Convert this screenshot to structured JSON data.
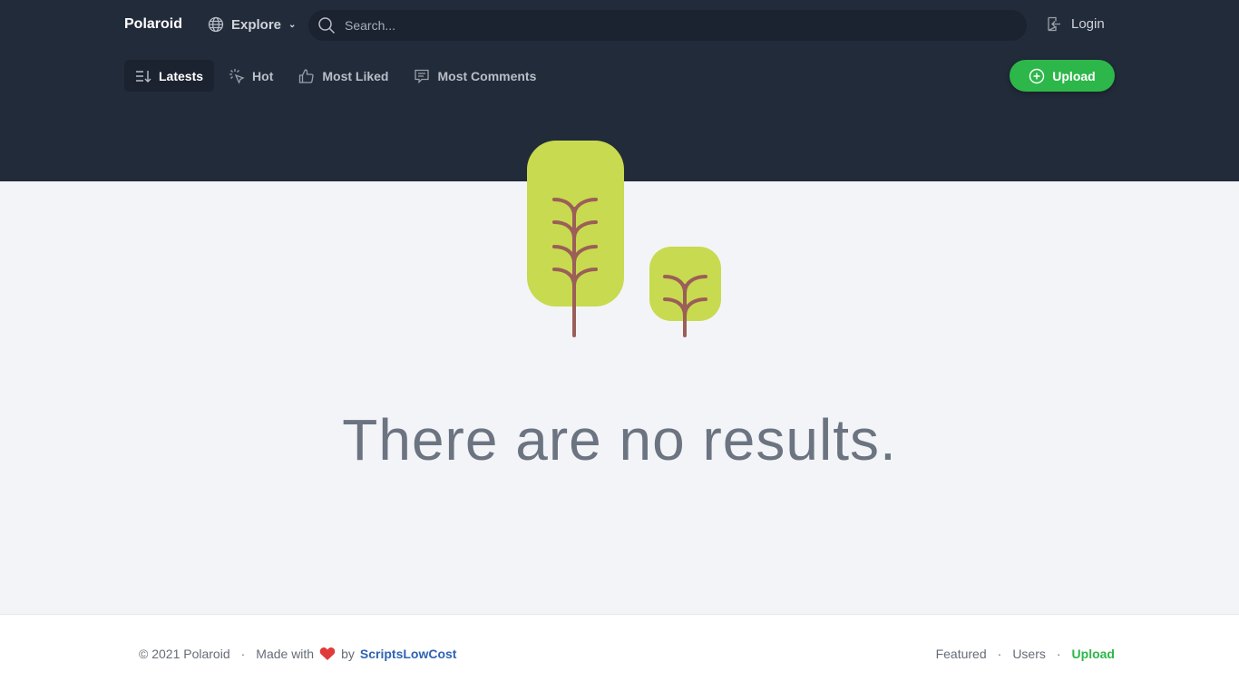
{
  "header": {
    "brand": "Polaroid",
    "explore": "Explore",
    "search_placeholder": "Search...",
    "login": "Login",
    "upload": "Upload"
  },
  "tabs": [
    {
      "label": "Latests",
      "icon": "sort-icon"
    },
    {
      "label": "Hot",
      "icon": "sparkle-cursor-icon"
    },
    {
      "label": "Most Liked",
      "icon": "thumbs-up-icon"
    },
    {
      "label": "Most Comments",
      "icon": "comment-icon"
    }
  ],
  "main": {
    "message": "There are no results."
  },
  "colors": {
    "header": "#222b3a",
    "accent": "#2db74a",
    "tree": "#c8da4f",
    "trunk": "#9b5e58"
  },
  "footer": {
    "copyright": "© 2021 Polaroid",
    "sep": "·",
    "made_with": "Made with",
    "by": "by",
    "author": "ScriptsLowCost",
    "links": [
      "Featured",
      "Users",
      "Upload"
    ]
  }
}
